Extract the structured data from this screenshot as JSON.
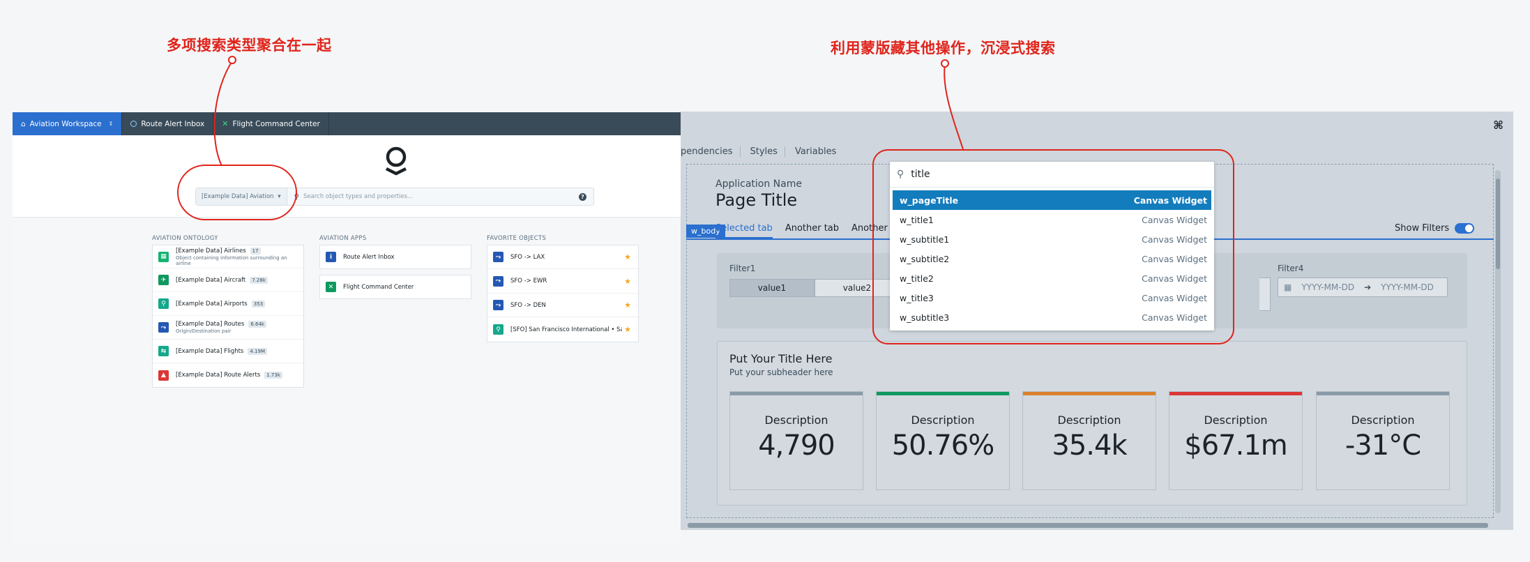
{
  "annotations": {
    "left": "多项搜索类型聚合在一起",
    "right": "利用蒙版藏其他操作，沉浸式搜索"
  },
  "left_app": {
    "topbar": {
      "workspace": "Aviation Workspace",
      "tabs": [
        "Route Alert Inbox",
        "Flight Command Center"
      ]
    },
    "search": {
      "scope": "[Example Data] Aviation",
      "placeholder": "Search object types and properties..."
    },
    "ontology": {
      "heading": "AVIATION ONTOLOGY",
      "items": [
        {
          "label": "[Example Data] Airlines",
          "count": "17",
          "sub": "Object containing information surrounding an airline",
          "color": "#15b371",
          "icon": "building-icon"
        },
        {
          "label": "[Example Data] Aircraft",
          "count": "7.28k",
          "sub": "",
          "color": "#0f9960",
          "icon": "plane-icon"
        },
        {
          "label": "[Example Data] Airports",
          "count": "353",
          "sub": "",
          "color": "#14a88c",
          "icon": "pin-icon"
        },
        {
          "label": "[Example Data] Routes",
          "count": "6.64k",
          "sub": "Origin/Destination pair",
          "color": "#2458b3",
          "icon": "route-icon"
        },
        {
          "label": "[Example Data] Flights",
          "count": "4.19M",
          "sub": "",
          "color": "#14a88c",
          "icon": "arrows-icon"
        },
        {
          "label": "[Example Data] Route Alerts",
          "count": "1.73k",
          "sub": "",
          "color": "#db3737",
          "icon": "warning-icon"
        }
      ]
    },
    "apps": {
      "heading": "AVIATION APPS",
      "items": [
        {
          "label": "Route Alert Inbox",
          "color": "#2458b3",
          "icon": "info-icon"
        },
        {
          "label": "Flight Command Center",
          "color": "#0f9960",
          "icon": "plane-icon"
        }
      ]
    },
    "favorites": {
      "heading": "FAVORITE OBJECTS",
      "items": [
        {
          "label": "SFO -> LAX",
          "color": "#2458b3",
          "icon": "route-icon"
        },
        {
          "label": "SFO -> EWR",
          "color": "#2458b3",
          "icon": "route-icon"
        },
        {
          "label": "SFO -> DEN",
          "color": "#2458b3",
          "icon": "route-icon"
        },
        {
          "label": "[SFO] San Francisco International • San Fra...",
          "color": "#14a88c",
          "icon": "pin-icon"
        }
      ]
    }
  },
  "right_app": {
    "editor_tabs": [
      "pendencies",
      "Styles",
      "Variables"
    ],
    "app_name": "Application Name",
    "page_title": "Page Title",
    "w_body": "w_body",
    "tabs": [
      "Selected tab",
      "Another tab",
      "Another tab"
    ],
    "show_filters": "Show Filters",
    "filter1": {
      "label": "Filter1",
      "options": [
        "value1",
        "value2"
      ]
    },
    "filter4": {
      "label": "Filter4",
      "from": "YYYY-MM-DD",
      "to": "YYYY-MM-DD"
    },
    "section": {
      "title": "Put Your Title Here",
      "subtitle": "Put your subheader here"
    },
    "metrics": [
      {
        "desc": "Description",
        "value": "4,790",
        "color": "#8a9ba8"
      },
      {
        "desc": "Description",
        "value": "50.76%",
        "color": "#0f9960"
      },
      {
        "desc": "Description",
        "value": "35.4k",
        "color": "#d9822b"
      },
      {
        "desc": "Description",
        "value": "$67.1m",
        "color": "#db3737"
      },
      {
        "desc": "Description",
        "value": "-31°C",
        "color": "#8a9ba8"
      }
    ],
    "dropdown": {
      "query": "title",
      "items": [
        {
          "name": "w_pageTitle",
          "type": "Canvas Widget"
        },
        {
          "name": "w_title1",
          "type": "Canvas Widget"
        },
        {
          "name": "w_subtitle1",
          "type": "Canvas Widget"
        },
        {
          "name": "w_subtitle2",
          "type": "Canvas Widget"
        },
        {
          "name": "w_title2",
          "type": "Canvas Widget"
        },
        {
          "name": "w_title3",
          "type": "Canvas Widget"
        },
        {
          "name": "w_subtitle3",
          "type": "Canvas Widget"
        }
      ]
    }
  }
}
